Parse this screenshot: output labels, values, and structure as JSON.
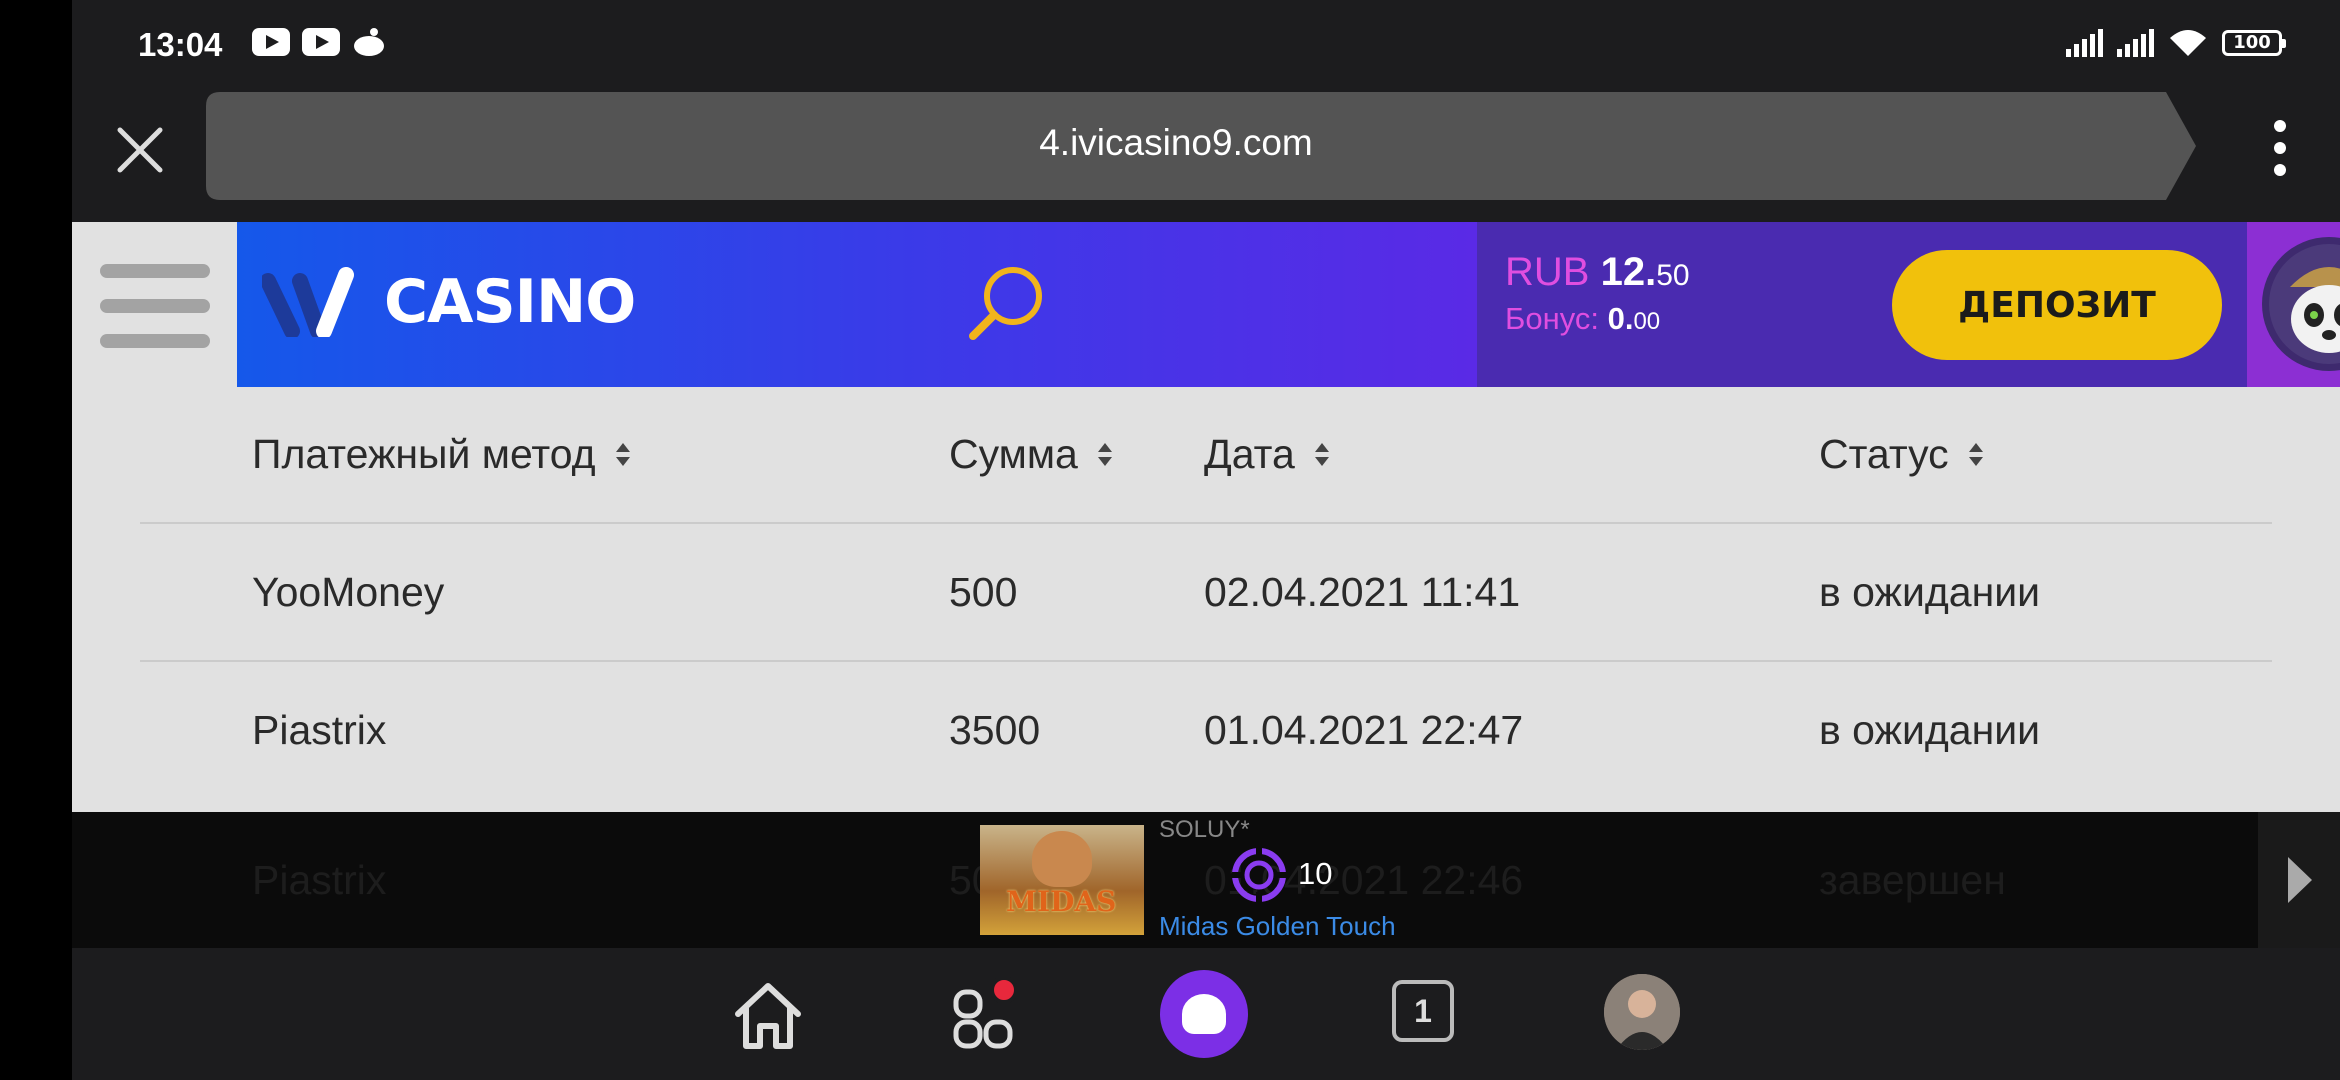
{
  "status_bar": {
    "time": "13:04",
    "notification_icons": [
      "youtube-icon",
      "youtube-icon",
      "reddit-icon"
    ],
    "battery": "100"
  },
  "browser": {
    "url": "4.ivicasino9.com"
  },
  "site": {
    "logo_text": "CASINO",
    "balance": {
      "currency": "RUB",
      "amount_main": "12.",
      "amount_cents": "50"
    },
    "bonus": {
      "label": "Бонус:",
      "amount_main": "0.",
      "amount_cents": "00"
    },
    "deposit_label": "ДЕПОЗИТ"
  },
  "table": {
    "columns": [
      "Платежный метод",
      "Сумма",
      "Дата",
      "Статус"
    ],
    "rows": [
      {
        "method": "YooMoney",
        "amount": "500",
        "date": "02.04.2021 11:41",
        "status": "в ожидании"
      },
      {
        "method": "Piastrix",
        "amount": "3500",
        "date": "01.04.2021 22:47",
        "status": "в ожидании"
      },
      {
        "method": "Piastrix",
        "amount": "50",
        "date": "01.04.2021 22:46",
        "status": "завершен"
      }
    ]
  },
  "player": {
    "channel": "SOLUY*",
    "thumbnail_text": "MIDAS",
    "coins": "10",
    "title": "Midas Golden Touch"
  },
  "nav": {
    "tabs_count": "1"
  },
  "colors": {
    "accent_purple": "#7c2fe6",
    "deposit_yellow": "#f1c10c",
    "balance_pink": "#e04ee0",
    "link_blue": "#3b8be6"
  }
}
